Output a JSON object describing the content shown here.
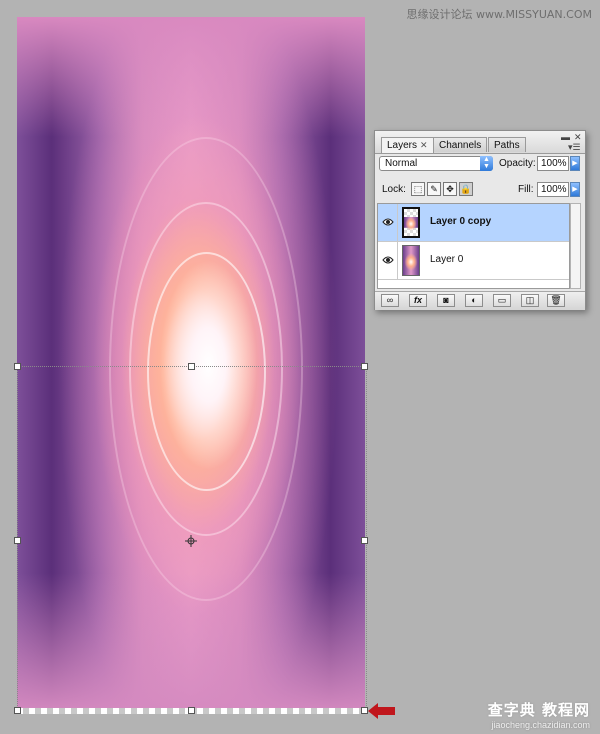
{
  "watermark": {
    "top": "思缘设计论坛 www.MISSYUAN.COM",
    "bottom_main": "查字典 教程网",
    "bottom_url": "jiaocheng.chazidian.com"
  },
  "layers_panel": {
    "tabs": [
      {
        "label": "Layers",
        "active": true
      },
      {
        "label": "Channels",
        "active": false
      },
      {
        "label": "Paths",
        "active": false
      }
    ],
    "blend_mode": "Normal",
    "opacity_label": "Opacity:",
    "opacity_value": "100%",
    "lock_label": "Lock:",
    "fill_label": "Fill:",
    "fill_value": "100%",
    "layers": [
      {
        "name": "Layer 0 copy",
        "selected": true,
        "visible": true
      },
      {
        "name": "Layer 0",
        "selected": false,
        "visible": true
      }
    ],
    "bottom_buttons": [
      "link-icon",
      "fx-icon",
      "mask-icon",
      "adjustment-icon",
      "group-icon",
      "new-layer-icon",
      "trash-icon"
    ],
    "fx_label": "fx"
  },
  "colors": {
    "selection_highlight": "#b5d4ff",
    "arrow": "#c0161c",
    "workspace": "#b3b3b3"
  }
}
